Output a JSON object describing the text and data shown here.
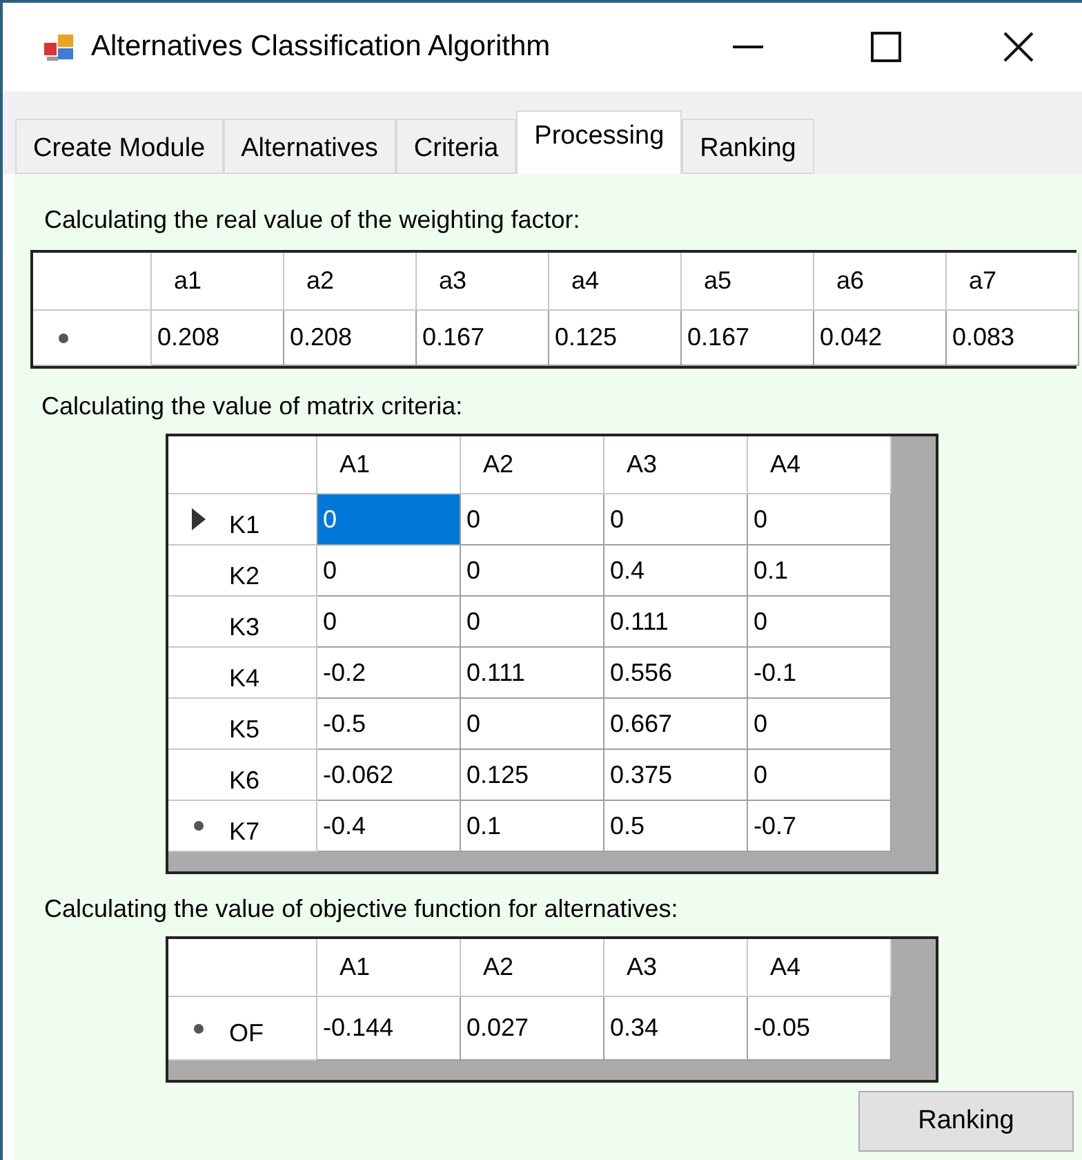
{
  "window": {
    "title": "Alternatives Classification Algorithm"
  },
  "tabs": [
    {
      "label": "Create Module",
      "selected": false
    },
    {
      "label": "Alternatives",
      "selected": false
    },
    {
      "label": "Criteria",
      "selected": false
    },
    {
      "label": "Processing",
      "selected": true
    },
    {
      "label": "Ranking",
      "selected": false
    }
  ],
  "weights": {
    "caption": "Calculating the real value of the weighting factor:",
    "columns": [
      "a1",
      "a2",
      "a3",
      "a4",
      "a5",
      "a6",
      "a7"
    ],
    "rows": [
      {
        "kind": "new",
        "label": "",
        "cells": [
          {
            "text": "0.208",
            "selected": false
          },
          {
            "text": "0.208",
            "selected": false
          },
          {
            "text": "0.167",
            "selected": false
          },
          {
            "text": "0.125",
            "selected": false
          },
          {
            "text": "0.167",
            "selected": false
          },
          {
            "text": "0.042",
            "selected": false
          },
          {
            "text": "0.083",
            "selected": false
          }
        ]
      }
    ]
  },
  "matrix": {
    "caption": "Calculating the value of matrix criteria:",
    "columns": [
      "A1",
      "A2",
      "A3",
      "A4"
    ],
    "rows": [
      {
        "kind": "current",
        "label": "K1",
        "cells": [
          {
            "text": "0",
            "selected": true
          },
          {
            "text": "0",
            "selected": false
          },
          {
            "text": "0",
            "selected": false
          },
          {
            "text": "0",
            "selected": false
          }
        ]
      },
      {
        "kind": "plain",
        "label": "K2",
        "cells": [
          {
            "text": "0",
            "selected": false
          },
          {
            "text": "0",
            "selected": false
          },
          {
            "text": "0.4",
            "selected": false
          },
          {
            "text": "0.1",
            "selected": false
          }
        ]
      },
      {
        "kind": "plain",
        "label": "K3",
        "cells": [
          {
            "text": "0",
            "selected": false
          },
          {
            "text": "0",
            "selected": false
          },
          {
            "text": "0.111",
            "selected": false
          },
          {
            "text": "0",
            "selected": false
          }
        ]
      },
      {
        "kind": "plain",
        "label": "K4",
        "cells": [
          {
            "text": "-0.2",
            "selected": false
          },
          {
            "text": "0.111",
            "selected": false
          },
          {
            "text": "0.556",
            "selected": false
          },
          {
            "text": "-0.1",
            "selected": false
          }
        ]
      },
      {
        "kind": "plain",
        "label": "K5",
        "cells": [
          {
            "text": "-0.5",
            "selected": false
          },
          {
            "text": "0",
            "selected": false
          },
          {
            "text": "0.667",
            "selected": false
          },
          {
            "text": "0",
            "selected": false
          }
        ]
      },
      {
        "kind": "plain",
        "label": "K6",
        "cells": [
          {
            "text": "-0.062",
            "selected": false
          },
          {
            "text": "0.125",
            "selected": false
          },
          {
            "text": "0.375",
            "selected": false
          },
          {
            "text": "0",
            "selected": false
          }
        ]
      },
      {
        "kind": "new",
        "label": "K7",
        "cells": [
          {
            "text": "-0.4",
            "selected": false
          },
          {
            "text": "0.1",
            "selected": false
          },
          {
            "text": "0.5",
            "selected": false
          },
          {
            "text": "-0.7",
            "selected": false
          }
        ]
      }
    ]
  },
  "objective": {
    "caption": "Calculating the value of objective function for alternatives:",
    "columns": [
      "A1",
      "A2",
      "A3",
      "A4"
    ],
    "rows": [
      {
        "kind": "new",
        "label": "OF",
        "cells": [
          {
            "text": "-0.144",
            "selected": false
          },
          {
            "text": "0.027",
            "selected": false
          },
          {
            "text": "0.34",
            "selected": false
          },
          {
            "text": "-0.05",
            "selected": false
          }
        ]
      }
    ]
  },
  "button": {
    "label": "Ranking"
  }
}
